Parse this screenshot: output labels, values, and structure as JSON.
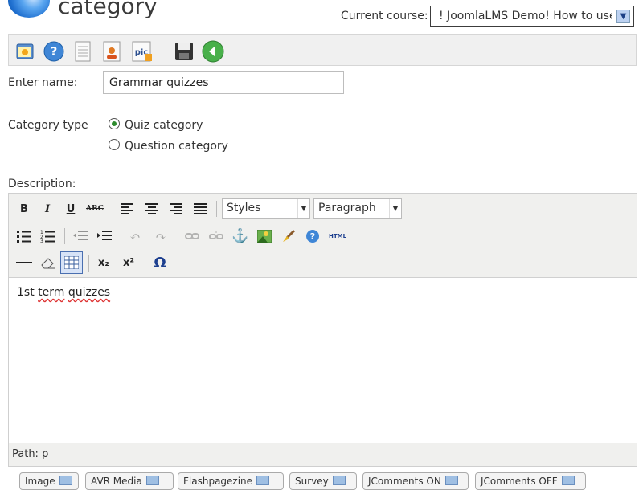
{
  "header": {
    "title": "category",
    "current_course_label": "Current course:",
    "current_course_value": "! JoomlaLMS Demo! How to use"
  },
  "main_toolbar": {
    "icons": [
      "settings-icon",
      "help-icon",
      "document-icon",
      "user-page-icon",
      "picture-icon",
      "save-icon",
      "back-icon"
    ]
  },
  "form": {
    "name_label": "Enter name:",
    "name_value": "Grammar quizzes",
    "category_type_label": "Category type",
    "radio_quiz": "Quiz category",
    "radio_question": "Question category",
    "selected_type": "Quiz category",
    "description_label": "Description:"
  },
  "editor": {
    "styles_select": "Styles",
    "paragraph_select": "Paragraph",
    "content_prefix": "1st ",
    "content_word1": "term",
    "content_space": " ",
    "content_word2": "quizzes",
    "path": "Path: p",
    "buttons": {
      "bold": "B",
      "italic": "I",
      "underline": "U",
      "strike": "ABC",
      "subscript": "x₂",
      "superscript": "x²",
      "omega": "Ω",
      "html": "HTML"
    }
  },
  "bottom_buttons": [
    "Image",
    "AVR Media",
    "Flashpagezine",
    "Survey",
    "JComments ON",
    "JComments OFF"
  ],
  "colors": {
    "accent": "#2e6fbd",
    "toolbar_bg": "#f0f0ee"
  }
}
